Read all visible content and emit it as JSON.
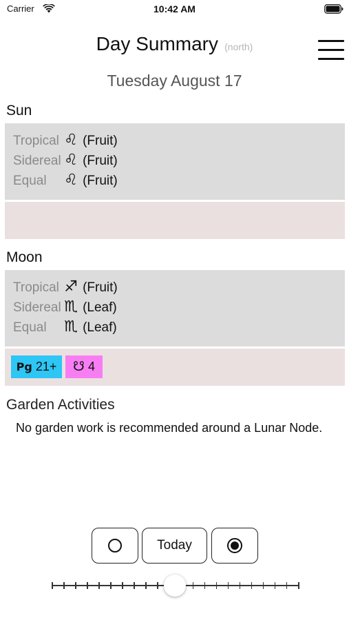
{
  "status_bar": {
    "carrier": "Carrier",
    "time": "10:42 AM"
  },
  "header": {
    "title": "Day Summary",
    "hemisphere": "(north)"
  },
  "date": "Tuesday August 17",
  "sun": {
    "title": "Sun",
    "rows": [
      {
        "label": "Tropical",
        "sign": "♌",
        "element": "(Fruit)"
      },
      {
        "label": "Sidereal",
        "sign": "♌",
        "element": "(Fruit)"
      },
      {
        "label": "Equal",
        "sign": "♌",
        "element": "(Fruit)"
      }
    ]
  },
  "moon": {
    "title": "Moon",
    "rows": [
      {
        "label": "Tropical",
        "sign": "♐",
        "element": "(Fruit)"
      },
      {
        "label": "Sidereal",
        "sign": "♏",
        "element": "(Leaf)"
      },
      {
        "label": "Equal",
        "sign": "♏",
        "element": "(Leaf)"
      }
    ],
    "badges": {
      "perigee_symbol": "Pg",
      "perigee_value": "21+",
      "node_symbol": "☋",
      "node_value": "4"
    }
  },
  "garden": {
    "title": "Garden Activities",
    "text": "No garden work is recommended around a Lunar Node."
  },
  "controls": {
    "today_label": "Today"
  },
  "slider": {
    "position": 0.5
  },
  "colors": {
    "zodiac_box": "#dcdcdc",
    "pink_box": "#ebe0e0",
    "perigee_badge": "#2dc6f5",
    "node_badge": "#f77ef2"
  }
}
